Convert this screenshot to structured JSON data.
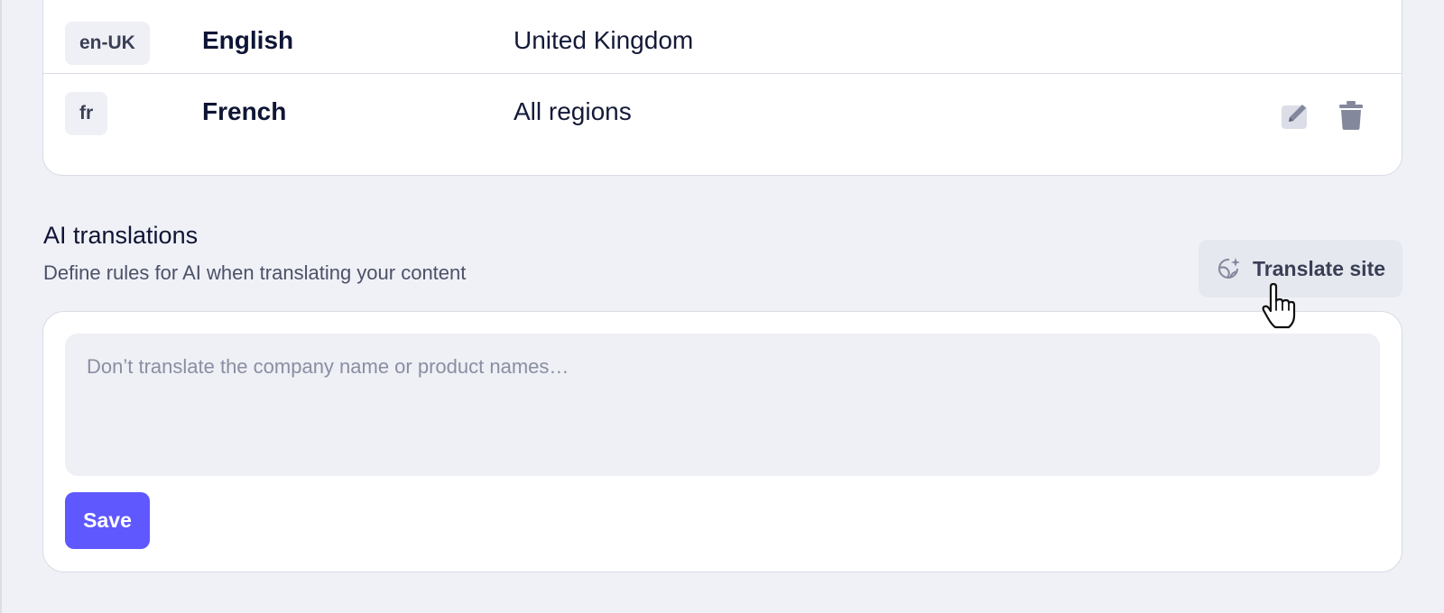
{
  "locales": {
    "rows": [
      {
        "code": "en-UK",
        "language": "English",
        "region": "United Kingdom"
      },
      {
        "code": "fr",
        "language": "French",
        "region": "All regions"
      }
    ],
    "actions": {
      "edit_icon": "pencil-icon",
      "delete_icon": "trash-icon"
    }
  },
  "ai_translations": {
    "title": "AI translations",
    "subtitle": "Define rules for AI when translating your content",
    "translate_button": {
      "label": "Translate site",
      "icon": "globe-sparkle-icon"
    },
    "rules_input": {
      "placeholder": "Don’t translate the company name or product names…",
      "value": ""
    },
    "save_label": "Save"
  },
  "colors": {
    "accent": "#5f58ff",
    "background": "#f0f1f6",
    "card": "#ffffff",
    "badge_bg": "#eef0f5",
    "icon_gray": "#8a8ea2"
  }
}
